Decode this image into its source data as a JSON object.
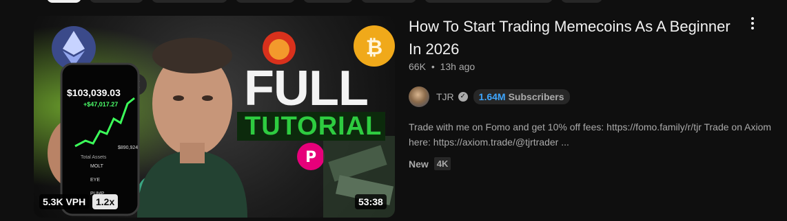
{
  "video": {
    "title": "How To Start Trading Memecoins As A Beginner In 2026",
    "views": "66K",
    "age": "13h ago",
    "separator": "•",
    "duration": "53:38",
    "vph_badge": "5.3K VPH",
    "speed_badge": "1.2x",
    "channel": {
      "name": "TJR",
      "verified_icon": "verified-check-icon",
      "subscriber_count": "1.64M",
      "subscriber_label": "Subscribers"
    },
    "description": "Trade with me on Fomo and get 10% off fees: https://fomo.family/r/tjr Trade on Axiom here: https://axiom.trade/@tjrtrader ...",
    "tags": [
      "New",
      "4K"
    ]
  },
  "thumbnail": {
    "headline_1": "FULL",
    "headline_2": "TUTORIAL",
    "phone_balance": "$103,039.03",
    "phone_gain": "+$47,017.27",
    "phone_total_label": "Total Assets",
    "phone_total_value": "$890,924",
    "phone_row_1": "MOLT",
    "phone_row_2": "EYE",
    "phone_row_3": "PUMP"
  },
  "colors": {
    "background": "#0f0f0f",
    "subs_count": "#3ea6ff",
    "secondary_text": "#aaaaaa",
    "tutorial_green": "#2ecc40"
  }
}
